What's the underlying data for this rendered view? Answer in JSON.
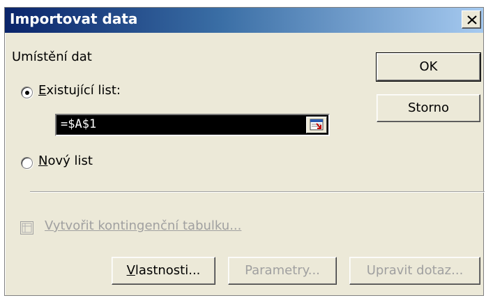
{
  "window": {
    "title": "Importovat data"
  },
  "location": {
    "group_label": "Umístění dat",
    "existing_sheet": {
      "label_accel": "E",
      "label_rest": "xistující list:",
      "selected": true
    },
    "reference_value": "=$A$1",
    "new_sheet": {
      "label_accel": "N",
      "label_rest": "ový list",
      "selected": false
    }
  },
  "pivot": {
    "label": "Vytvořit kontingenční tabulku..."
  },
  "buttons": {
    "ok": "OK",
    "cancel": "Storno",
    "properties_accel": "V",
    "properties_rest": "lastnosti...",
    "parameters": "Parametry...",
    "edit_query": "Upravit dotaz..."
  },
  "icons": {
    "close": "close-icon",
    "collapse": "collapse-dialog-icon",
    "pivot": "pivot-table-checkbox"
  }
}
